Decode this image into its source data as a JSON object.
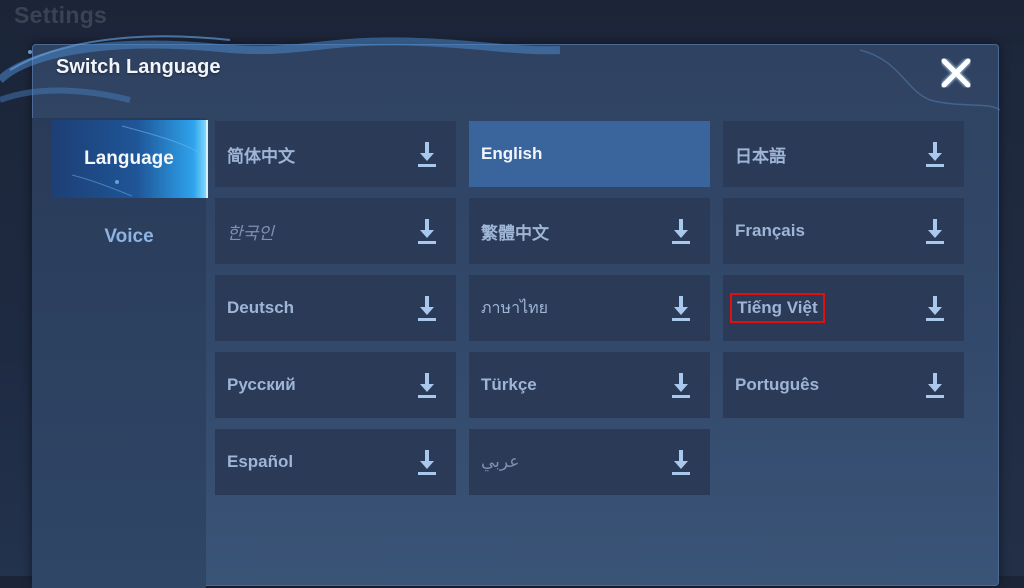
{
  "background": {
    "title": "Settings"
  },
  "dialog": {
    "title": "Switch Language",
    "close_icon": "close-x-icon"
  },
  "sidebar": {
    "tabs": [
      {
        "label": "Language",
        "active": true
      },
      {
        "label": "Voice",
        "active": false
      }
    ]
  },
  "languages": [
    {
      "label": "简体中文",
      "download_icon": "download-icon",
      "selected": false
    },
    {
      "label": "English",
      "download_icon": null,
      "selected": true
    },
    {
      "label": "日本語",
      "download_icon": "download-icon",
      "selected": false
    },
    {
      "label": "한국인",
      "download_icon": "download-icon",
      "selected": false
    },
    {
      "label": "繁體中文",
      "download_icon": "download-icon",
      "selected": false
    },
    {
      "label": "Français",
      "download_icon": "download-icon",
      "selected": false
    },
    {
      "label": "Deutsch",
      "download_icon": "download-icon",
      "selected": false
    },
    {
      "label": "ภาษาไทย",
      "download_icon": "download-icon",
      "selected": false
    },
    {
      "label": "Tiếng Việt",
      "download_icon": "download-icon",
      "selected": false,
      "highlighted": true
    },
    {
      "label": "Русский",
      "download_icon": "download-icon",
      "selected": false
    },
    {
      "label": "Türkçe",
      "download_icon": "download-icon",
      "selected": false
    },
    {
      "label": "Português",
      "download_icon": "download-icon",
      "selected": false
    },
    {
      "label": "Español",
      "download_icon": "download-icon",
      "selected": false
    },
    {
      "label": "عربي",
      "download_icon": "download-icon",
      "selected": false
    }
  ],
  "colors": {
    "selected_item": "#3a649c",
    "item_bg": "#2a3a57",
    "highlight_box": "#e01010",
    "active_tab_glow": "#2ea3ec"
  }
}
